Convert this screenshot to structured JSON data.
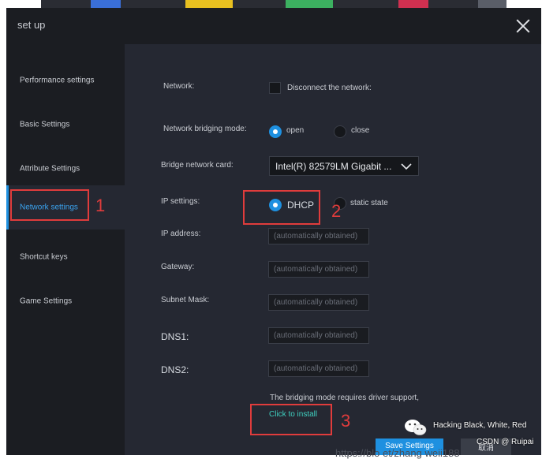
{
  "window": {
    "title": "set up"
  },
  "sidebar": {
    "items": [
      {
        "label": "Performance settings"
      },
      {
        "label": "Basic Settings"
      },
      {
        "label": "Attribute Settings"
      },
      {
        "label": "Network settings",
        "active": true
      },
      {
        "label": "Shortcut keys"
      },
      {
        "label": "Game Settings"
      }
    ]
  },
  "network": {
    "network_label": "Network:",
    "disconnect_label": "Disconnect the network:",
    "bridging_label": "Network bridging mode:",
    "bridging_open": "open",
    "bridging_close": "close",
    "bridge_card_label": "Bridge network card:",
    "bridge_card_value": "Intel(R) 82579LM Gigabit ...",
    "ip_settings_label": "IP settings:",
    "ip_dhcp": "DHCP",
    "ip_static": "static state",
    "ip_address_label": "IP address:",
    "gateway_label": "Gateway:",
    "subnet_label": "Subnet Mask:",
    "dns1_label": "DNS1:",
    "dns2_label": "DNS2:",
    "auto_placeholder": "(automatically obtained)",
    "driver_note": "The bridging mode requires driver support,",
    "install_link": "Click to install"
  },
  "buttons": {
    "save": "Save Settings",
    "cancel": "取消"
  },
  "annotations": {
    "marker1": "1",
    "marker2": "2",
    "marker3": "3"
  },
  "watermark": {
    "line1": "Hacking Black, White, Red",
    "line2": "CSDN @ Ruipai",
    "url": "https://blo              et/zhang  weii188"
  },
  "colors": {
    "accent": "#1e90e0",
    "link": "#3fd0c0",
    "annotation": "#e03c3c"
  }
}
